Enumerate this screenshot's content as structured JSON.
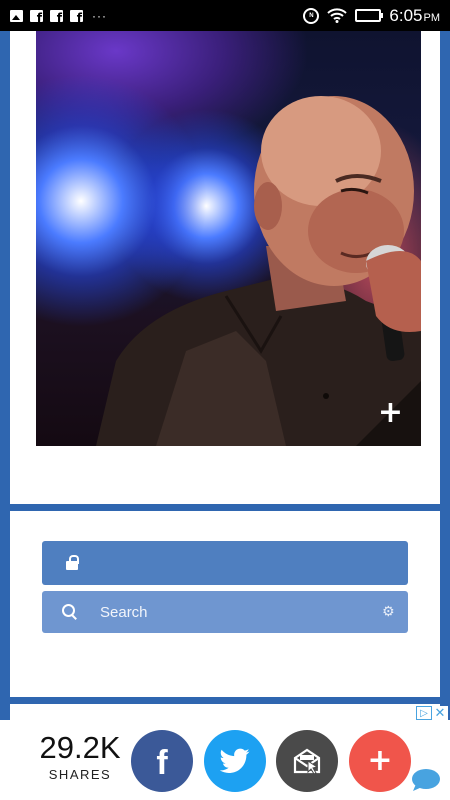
{
  "status_bar": {
    "time": "6:05",
    "ampm": "PM",
    "more_glyph": "···",
    "nfc_label": "N"
  },
  "photo": {
    "expand_glyph": "+"
  },
  "search": {
    "placeholder": "Search",
    "settings_glyph": "⚙"
  },
  "ad": {
    "choices_glyph": "▷",
    "close_glyph": "✕"
  },
  "share": {
    "count": "29.2K",
    "label": "SHARES",
    "facebook_glyph": "f",
    "more_glyph": "+"
  },
  "colors": {
    "page_background": "#2f66b0",
    "facebook": "#3b5998",
    "twitter": "#1da1f2",
    "email": "#4a4a4a",
    "more": "#f0554b",
    "login_bar": "#4f7fc0",
    "search_bar": "#6f96d0"
  },
  "icons": [
    "image-icon",
    "facebook-notification-icon",
    "nfc-icon",
    "wifi-icon",
    "battery-icon",
    "lock-icon",
    "search-icon",
    "gear-icon",
    "ad-choices-icon",
    "close-icon",
    "twitter-bird-icon",
    "email-icon",
    "chat-bubble-icon"
  ]
}
